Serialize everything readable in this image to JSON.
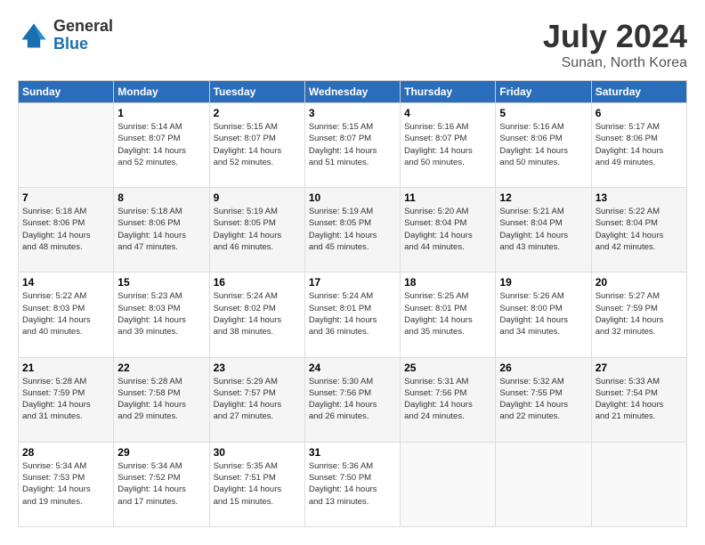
{
  "logo": {
    "general": "General",
    "blue": "Blue"
  },
  "title": "July 2024",
  "subtitle": "Sunan, North Korea",
  "days_of_week": [
    "Sunday",
    "Monday",
    "Tuesday",
    "Wednesday",
    "Thursday",
    "Friday",
    "Saturday"
  ],
  "weeks": [
    [
      {
        "day": "",
        "info": ""
      },
      {
        "day": "1",
        "info": "Sunrise: 5:14 AM\nSunset: 8:07 PM\nDaylight: 14 hours\nand 52 minutes."
      },
      {
        "day": "2",
        "info": "Sunrise: 5:15 AM\nSunset: 8:07 PM\nDaylight: 14 hours\nand 52 minutes."
      },
      {
        "day": "3",
        "info": "Sunrise: 5:15 AM\nSunset: 8:07 PM\nDaylight: 14 hours\nand 51 minutes."
      },
      {
        "day": "4",
        "info": "Sunrise: 5:16 AM\nSunset: 8:07 PM\nDaylight: 14 hours\nand 50 minutes."
      },
      {
        "day": "5",
        "info": "Sunrise: 5:16 AM\nSunset: 8:06 PM\nDaylight: 14 hours\nand 50 minutes."
      },
      {
        "day": "6",
        "info": "Sunrise: 5:17 AM\nSunset: 8:06 PM\nDaylight: 14 hours\nand 49 minutes."
      }
    ],
    [
      {
        "day": "7",
        "info": "Sunrise: 5:18 AM\nSunset: 8:06 PM\nDaylight: 14 hours\nand 48 minutes."
      },
      {
        "day": "8",
        "info": "Sunrise: 5:18 AM\nSunset: 8:06 PM\nDaylight: 14 hours\nand 47 minutes."
      },
      {
        "day": "9",
        "info": "Sunrise: 5:19 AM\nSunset: 8:05 PM\nDaylight: 14 hours\nand 46 minutes."
      },
      {
        "day": "10",
        "info": "Sunrise: 5:19 AM\nSunset: 8:05 PM\nDaylight: 14 hours\nand 45 minutes."
      },
      {
        "day": "11",
        "info": "Sunrise: 5:20 AM\nSunset: 8:04 PM\nDaylight: 14 hours\nand 44 minutes."
      },
      {
        "day": "12",
        "info": "Sunrise: 5:21 AM\nSunset: 8:04 PM\nDaylight: 14 hours\nand 43 minutes."
      },
      {
        "day": "13",
        "info": "Sunrise: 5:22 AM\nSunset: 8:04 PM\nDaylight: 14 hours\nand 42 minutes."
      }
    ],
    [
      {
        "day": "14",
        "info": "Sunrise: 5:22 AM\nSunset: 8:03 PM\nDaylight: 14 hours\nand 40 minutes."
      },
      {
        "day": "15",
        "info": "Sunrise: 5:23 AM\nSunset: 8:03 PM\nDaylight: 14 hours\nand 39 minutes."
      },
      {
        "day": "16",
        "info": "Sunrise: 5:24 AM\nSunset: 8:02 PM\nDaylight: 14 hours\nand 38 minutes."
      },
      {
        "day": "17",
        "info": "Sunrise: 5:24 AM\nSunset: 8:01 PM\nDaylight: 14 hours\nand 36 minutes."
      },
      {
        "day": "18",
        "info": "Sunrise: 5:25 AM\nSunset: 8:01 PM\nDaylight: 14 hours\nand 35 minutes."
      },
      {
        "day": "19",
        "info": "Sunrise: 5:26 AM\nSunset: 8:00 PM\nDaylight: 14 hours\nand 34 minutes."
      },
      {
        "day": "20",
        "info": "Sunrise: 5:27 AM\nSunset: 7:59 PM\nDaylight: 14 hours\nand 32 minutes."
      }
    ],
    [
      {
        "day": "21",
        "info": "Sunrise: 5:28 AM\nSunset: 7:59 PM\nDaylight: 14 hours\nand 31 minutes."
      },
      {
        "day": "22",
        "info": "Sunrise: 5:28 AM\nSunset: 7:58 PM\nDaylight: 14 hours\nand 29 minutes."
      },
      {
        "day": "23",
        "info": "Sunrise: 5:29 AM\nSunset: 7:57 PM\nDaylight: 14 hours\nand 27 minutes."
      },
      {
        "day": "24",
        "info": "Sunrise: 5:30 AM\nSunset: 7:56 PM\nDaylight: 14 hours\nand 26 minutes."
      },
      {
        "day": "25",
        "info": "Sunrise: 5:31 AM\nSunset: 7:56 PM\nDaylight: 14 hours\nand 24 minutes."
      },
      {
        "day": "26",
        "info": "Sunrise: 5:32 AM\nSunset: 7:55 PM\nDaylight: 14 hours\nand 22 minutes."
      },
      {
        "day": "27",
        "info": "Sunrise: 5:33 AM\nSunset: 7:54 PM\nDaylight: 14 hours\nand 21 minutes."
      }
    ],
    [
      {
        "day": "28",
        "info": "Sunrise: 5:34 AM\nSunset: 7:53 PM\nDaylight: 14 hours\nand 19 minutes."
      },
      {
        "day": "29",
        "info": "Sunrise: 5:34 AM\nSunset: 7:52 PM\nDaylight: 14 hours\nand 17 minutes."
      },
      {
        "day": "30",
        "info": "Sunrise: 5:35 AM\nSunset: 7:51 PM\nDaylight: 14 hours\nand 15 minutes."
      },
      {
        "day": "31",
        "info": "Sunrise: 5:36 AM\nSunset: 7:50 PM\nDaylight: 14 hours\nand 13 minutes."
      },
      {
        "day": "",
        "info": ""
      },
      {
        "day": "",
        "info": ""
      },
      {
        "day": "",
        "info": ""
      }
    ]
  ]
}
